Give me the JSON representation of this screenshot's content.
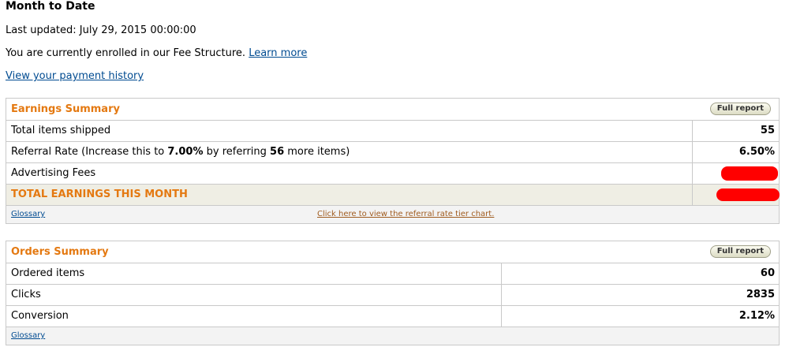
{
  "page": {
    "title": "Month to Date",
    "last_updated": "Last updated: July 29, 2015 00:00:00",
    "enrolled_text": "You are currently enrolled in our Fee Structure.",
    "learn_more": "Learn more",
    "payment_history": "View your payment history"
  },
  "earnings": {
    "title": "Earnings Summary",
    "full_report": "Full report",
    "rows": [
      {
        "label": "Total items shipped",
        "value": "55"
      },
      {
        "label_prefix": "Referral Rate (Increase this to ",
        "label_rate": "7.00%",
        "label_mid": " by referring ",
        "label_items": "56",
        "label_suffix": " more items)",
        "value": "6.50%"
      },
      {
        "label": "Advertising Fees",
        "value": ""
      },
      {
        "label": "TOTAL EARNINGS THIS MONTH",
        "value": ""
      }
    ],
    "glossary": "Glossary",
    "tier_chart_link": "Click here to view the referral rate tier chart."
  },
  "orders": {
    "title": "Orders Summary",
    "full_report": "Full report",
    "rows": [
      {
        "label": "Ordered items",
        "value": "60"
      },
      {
        "label": "Clicks",
        "value": "2835"
      },
      {
        "label": "Conversion",
        "value": "2.12%"
      }
    ],
    "glossary": "Glossary"
  },
  "colors": {
    "accent_orange": "#e47911",
    "link_blue": "#004b91",
    "redaction": "#ff0000"
  }
}
